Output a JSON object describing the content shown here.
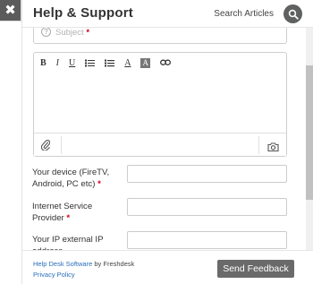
{
  "close": {
    "glyph": "✖"
  },
  "header": {
    "title": "Help & Support",
    "search_label": "Search Articles"
  },
  "form": {
    "subject_placeholder": "Subject",
    "required_mark": "*",
    "toolbar": {
      "bold": "B",
      "italic": "I",
      "underline": "U",
      "font_color": "A",
      "highlight": "A"
    },
    "fields": [
      {
        "label": "Your device (FireTV, Android, PC etc)",
        "required": true
      },
      {
        "label": "Internet Service Provider",
        "required": true
      },
      {
        "label": "Your IP external IP address",
        "required": false
      }
    ]
  },
  "footer": {
    "powered_link": "Help Desk Software",
    "by_text": " by Freshdesk",
    "privacy_link": "Privacy Policy",
    "send_label": "Send Feedback"
  },
  "colors": {
    "header_icon_bg": "#5f6060",
    "button_bg": "#6a6a6a",
    "link": "#2a6ebb",
    "required": "#d0021b"
  }
}
